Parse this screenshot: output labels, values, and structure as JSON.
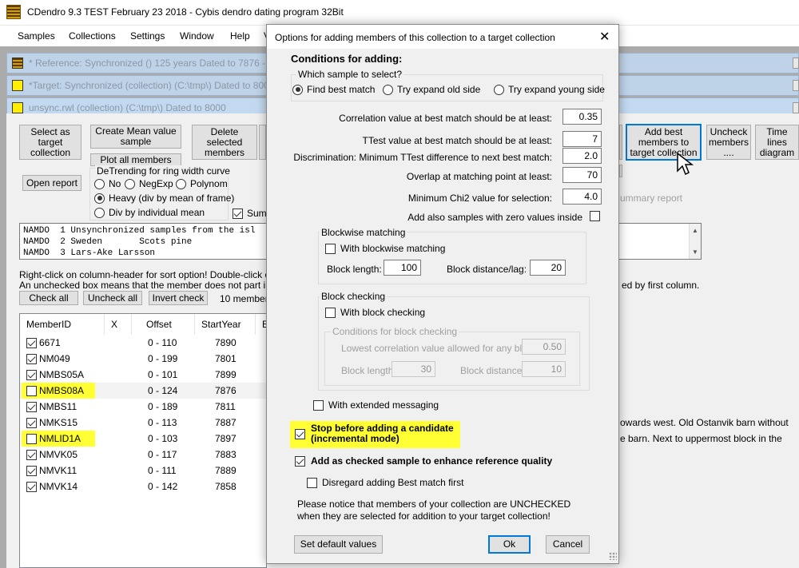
{
  "app": {
    "title": "CDendro 9.3  TEST February 23 2018 - Cybis dendro dating program  32Bit"
  },
  "menu": [
    "Samples",
    "Collections",
    "Settings",
    "Window",
    "Help",
    "V"
  ],
  "child_windows": [
    {
      "title": "* Reference: Synchronized   ()  125 years  Dated to 7876 -"
    },
    {
      "title": "*Target: Synchronized (collection)  (C:\\tmp\\) Dated to 800"
    },
    {
      "title": "unsync.rwl (collection)  (C:\\tmp\\) Dated to 8000"
    }
  ],
  "toolbar": {
    "select_target": "Select as target collection",
    "create_mean": "Create Mean value sample",
    "plot_all": "Plot all members",
    "delete_selected": "Delete selected members",
    "add_best": "Add best members to target collection",
    "uncheck": "Uncheck members ....",
    "time_lines": "Time lines diagram",
    "open_report": "Open report",
    "summary_report": "ummary report"
  },
  "detrending": {
    "label": "DeTrending for ring width curve",
    "options": [
      "No",
      "NegExp",
      "Polynom",
      "Heavy (div by mean of frame)",
      "Div by individual mean"
    ],
    "selected": "Heavy (div by mean of frame)"
  },
  "sum_label": "Sum b",
  "memo_lines": [
    "NAMDO  1 Unsynchronized samples from the isl",
    "NAMDO  2 Sweden       Scots pine",
    "NAMDO  3 Lars-Ake Larsson"
  ],
  "hints": {
    "line1": "Right-click on column-header for sort option! Double-click on a me",
    "line2": "An unchecked box means that the member does not part in calcul",
    "right": "ed by first column."
  },
  "check_buttons": {
    "check_all": "Check all",
    "uncheck_all": "Uncheck all",
    "invert": "Invert check",
    "count": "10 members,"
  },
  "table": {
    "headers": [
      "MemberID",
      "X",
      "Offset",
      "StartYear",
      "E"
    ],
    "rows": [
      {
        "id": "6671",
        "checked": true,
        "offset": "0 - 110",
        "start": "7890",
        "highlight": false
      },
      {
        "id": "NM049",
        "checked": true,
        "offset": "0 - 199",
        "start": "7801",
        "highlight": false
      },
      {
        "id": "NMBS05A",
        "checked": true,
        "offset": "0 - 101",
        "start": "7899",
        "highlight": false
      },
      {
        "id": "NMBS08A",
        "checked": false,
        "offset": "0 - 124",
        "start": "7876",
        "highlight": true
      },
      {
        "id": "NMBS11",
        "checked": true,
        "offset": "0 - 189",
        "start": "7811",
        "highlight": false
      },
      {
        "id": "NMKS15",
        "checked": true,
        "offset": "0 - 113",
        "start": "7887",
        "highlight": false
      },
      {
        "id": "NMLID1A",
        "checked": false,
        "offset": "0 - 103",
        "start": "7897",
        "highlight": true
      },
      {
        "id": "NMVK05",
        "checked": true,
        "offset": "0 - 117",
        "start": "7883",
        "highlight": false
      },
      {
        "id": "NMVK11",
        "checked": true,
        "offset": "0 - 111",
        "start": "7889",
        "highlight": false
      },
      {
        "id": "NMVK14",
        "checked": true,
        "offset": "0 - 142",
        "start": "7858",
        "highlight": false
      }
    ]
  },
  "right_text": {
    "line1": "owards west. Old Ostanvik barn without",
    "line2": "e barn. Next to uppermost block in the"
  },
  "dialog": {
    "title": "Options for adding members of this collection to a target collection",
    "conditions": "Conditions for adding:",
    "which_sample": "Which sample to select?",
    "radio_options": [
      "Find best match",
      "Try expand old side",
      "Try expand young side"
    ],
    "radio_selected": "Find best match",
    "fields": {
      "correlation": {
        "label": "Correlation value at best match should be at least:",
        "value": "0.35"
      },
      "ttest": {
        "label": "TTest value at best match should be at least:",
        "value": "7"
      },
      "discrimination": {
        "label": "Discrimination: Minimum TTest difference to next best match:",
        "value": "2.0"
      },
      "overlap": {
        "label": "Overlap at matching point at least:",
        "value": "70"
      },
      "chi2": {
        "label": "Minimum Chi2 value for selection:",
        "value": "4.0"
      }
    },
    "zero_values": "Add also samples with zero values inside",
    "blockwise": {
      "group": "Blockwise matching",
      "check": "With blockwise matching",
      "block_length_label": "Block length:",
      "block_length": "100",
      "distance_label": "Block distance/lag:",
      "distance": "20"
    },
    "blockcheck": {
      "group": "Block checking",
      "check": "With block checking",
      "cond_group": "Conditions for block checking",
      "lowest_label": "Lowest correlation value allowed for any block:",
      "lowest": "0.50",
      "length_label": "Block length:",
      "length": "30",
      "distance_label": "Block distance:",
      "distance": "10"
    },
    "extended": "With extended messaging",
    "stop_line1": "Stop before adding a candidate",
    "stop_line2": "(incremental mode)",
    "add_checked": "Add as checked sample to enhance reference quality",
    "disregard": "Disregard adding Best match first",
    "notice1": "Please notice that members of your collection are UNCHECKED",
    "notice2": "when they are selected for addition to your target collection!",
    "set_default": "Set default values",
    "ok": "Ok",
    "cancel": "Cancel"
  },
  "colors": {
    "highlight": "#ffff33",
    "focus": "#0078d7",
    "mdi_bg": "#ababab"
  }
}
